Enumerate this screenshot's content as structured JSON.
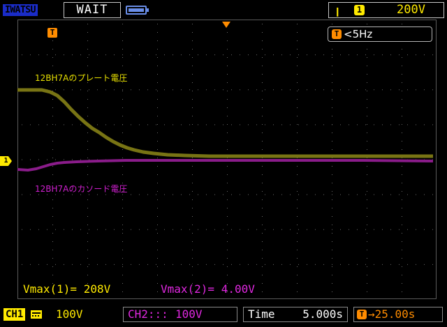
{
  "header": {
    "brand": "IWATSU",
    "run_state": "WAIT",
    "battery_icon": "battery-icon",
    "trigger_slope_symbol": "ꞁ",
    "trigger_source": "1",
    "trigger_level": "200V"
  },
  "display": {
    "trigger_marker": "T",
    "frequency_icon": "T",
    "frequency_readout": "<5Hz",
    "ch1_ground_marker": "1",
    "ch1_annotation": "12BH7Aのプレート電圧",
    "ch2_annotation": "12BH7Aのカソード電圧"
  },
  "measurements": {
    "ch1": "Vmax(1)= 208V",
    "ch2": "Vmax(2)= 4.00V"
  },
  "footer": {
    "ch1_label": "CH1",
    "ch1_coupling_icon": "dc-coupling-icon",
    "ch1_scale": "100V",
    "ch2_label": "CH2:::",
    "ch2_scale": "100V",
    "time_label": "Time",
    "time_value": "5.000s",
    "delay_icon": "T",
    "delay_value": "→25.00s"
  },
  "colors": {
    "ch1": "#ffea00",
    "ch2": "#e028e0",
    "trigger": "#ff8c00",
    "brand_bg": "#1a2cc8"
  }
}
